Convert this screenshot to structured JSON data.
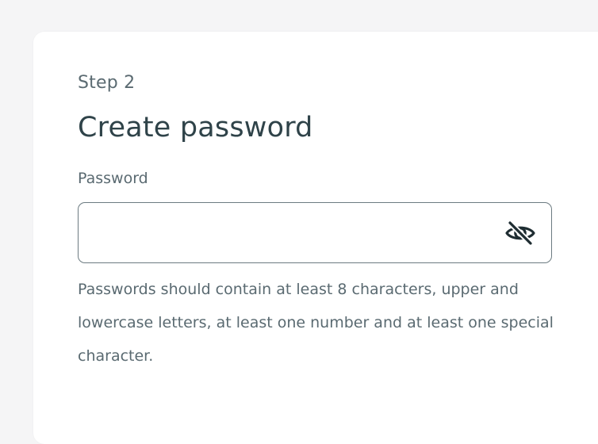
{
  "form": {
    "step_label": "Step 2",
    "title": "Create password",
    "password_label": "Password",
    "password_value": "",
    "password_placeholder": "",
    "visibility_toggle_icon": "eye-slash",
    "helper_text": "Passwords should contain at least 8 characters, upper and lowercase letters, at least one number and at least one special character."
  },
  "colors": {
    "background": "#f5f5f6",
    "card": "#ffffff",
    "text_primary": "#2f4349",
    "text_secondary": "#5a6a71",
    "field_border": "#6c7b81"
  }
}
